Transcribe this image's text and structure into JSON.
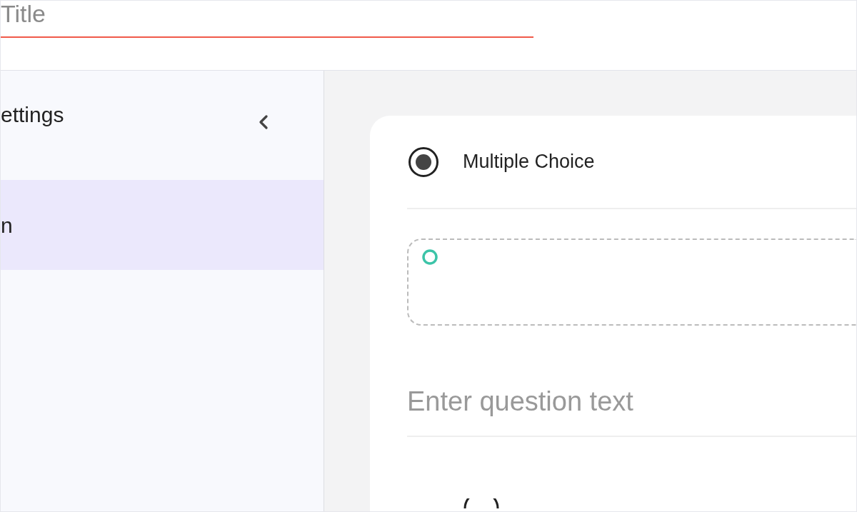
{
  "title_field": {
    "placeholder": "Title"
  },
  "sidebar": {
    "heading": "ettings",
    "items": [
      {
        "label": "n",
        "selected": true
      }
    ]
  },
  "question": {
    "type_option": {
      "label": "Multiple Choice",
      "selected": true
    },
    "text_field": {
      "placeholder": "Enter question text"
    }
  }
}
